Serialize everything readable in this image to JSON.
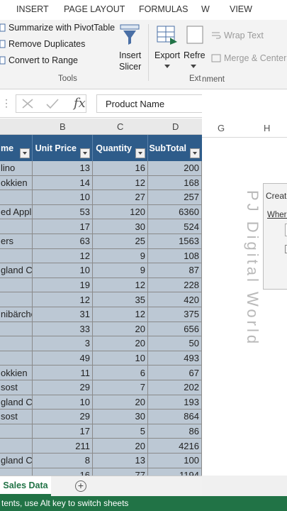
{
  "ribbon_tabs": [
    "INSERT",
    "PAGE LAYOUT",
    "FORMULAS",
    "W",
    "VIEW"
  ],
  "tools_group": {
    "items": [
      "Summarize with PivotTable",
      "Remove Duplicates",
      "Convert to Range"
    ],
    "insert_slicer": [
      "Insert",
      "Slicer"
    ],
    "label": "Tools"
  },
  "external_group": {
    "export": "Export",
    "refresh": "Refre",
    "label_part1": "Ext",
    "label_part2": "nment"
  },
  "alignment": {
    "wrap_text": "Wrap Text",
    "merge_center": "Merge & Center"
  },
  "formula_bar": {
    "fx": "fx",
    "value": "Product Name"
  },
  "columns": [
    "B",
    "C",
    "D",
    "G",
    "H"
  ],
  "table_headers": [
    "me",
    "Unit Price",
    "Quantity",
    "SubTotal"
  ],
  "rows": [
    [
      "lino",
      "13",
      "16",
      "200"
    ],
    [
      "okkien",
      "14",
      "12",
      "168"
    ],
    [
      "",
      "10",
      "27",
      "257"
    ],
    [
      "ed Appl",
      "53",
      "120",
      "6360"
    ],
    [
      "",
      "17",
      "30",
      "524"
    ],
    [
      "ers",
      "63",
      "25",
      "1563"
    ],
    [
      "",
      "12",
      "9",
      "108"
    ],
    [
      "gland Cl",
      "10",
      "9",
      "87"
    ],
    [
      "",
      "19",
      "12",
      "228"
    ],
    [
      "",
      "12",
      "35",
      "420"
    ],
    [
      "nibärche",
      "31",
      "12",
      "375"
    ],
    [
      "",
      "33",
      "20",
      "656"
    ],
    [
      "",
      "3",
      "20",
      "50"
    ],
    [
      "",
      "49",
      "10",
      "493"
    ],
    [
      "okkien",
      "11",
      "6",
      "67"
    ],
    [
      "sost",
      "29",
      "7",
      "202"
    ],
    [
      "gland Cl",
      "10",
      "20",
      "193"
    ],
    [
      "sost",
      "29",
      "30",
      "864"
    ],
    [
      "",
      "17",
      "5",
      "86"
    ],
    [
      "",
      "211",
      "20",
      "4216"
    ],
    [
      "gland Cl",
      "8",
      "13",
      "100"
    ],
    [
      "",
      "16",
      "77",
      "1194"
    ]
  ],
  "sheet_tab": "Sales Data",
  "status_text": "tents, use Alt key to switch sheets",
  "dialog": {
    "title": "Create",
    "label": "Where"
  },
  "watermark": "PJ Digital World",
  "colors": {
    "header": "#2e5c8a",
    "cell": "#bcc8d4",
    "excel_green": "#217346"
  }
}
